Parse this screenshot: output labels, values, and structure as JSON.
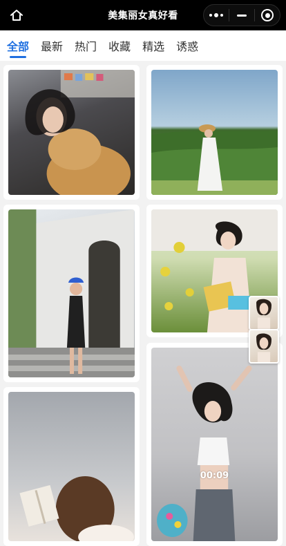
{
  "header": {
    "title": "美集丽女真好看",
    "home_icon": "home-icon",
    "capsule": {
      "more_icon": "more-dots-icon",
      "minimize_icon": "minimize-icon",
      "close_icon": "target-circle-icon"
    }
  },
  "tabs": [
    {
      "label": "全部",
      "active": true
    },
    {
      "label": "最新",
      "active": false
    },
    {
      "label": "热门",
      "active": false
    },
    {
      "label": "收藏",
      "active": false
    },
    {
      "label": "精选",
      "active": false
    },
    {
      "label": "诱惑",
      "active": false
    }
  ],
  "feed": {
    "cards": [
      {
        "id": "c1",
        "kind": "photo"
      },
      {
        "id": "c2",
        "kind": "photo"
      },
      {
        "id": "c3",
        "kind": "photo"
      },
      {
        "id": "c4",
        "kind": "photo"
      },
      {
        "id": "c5",
        "kind": "photo"
      },
      {
        "id": "c6",
        "kind": "video",
        "duration": "00:09"
      }
    ]
  },
  "colors": {
    "accent": "#1f6fe0",
    "topbar_bg": "#000000",
    "page_bg": "#f2f2f2"
  }
}
